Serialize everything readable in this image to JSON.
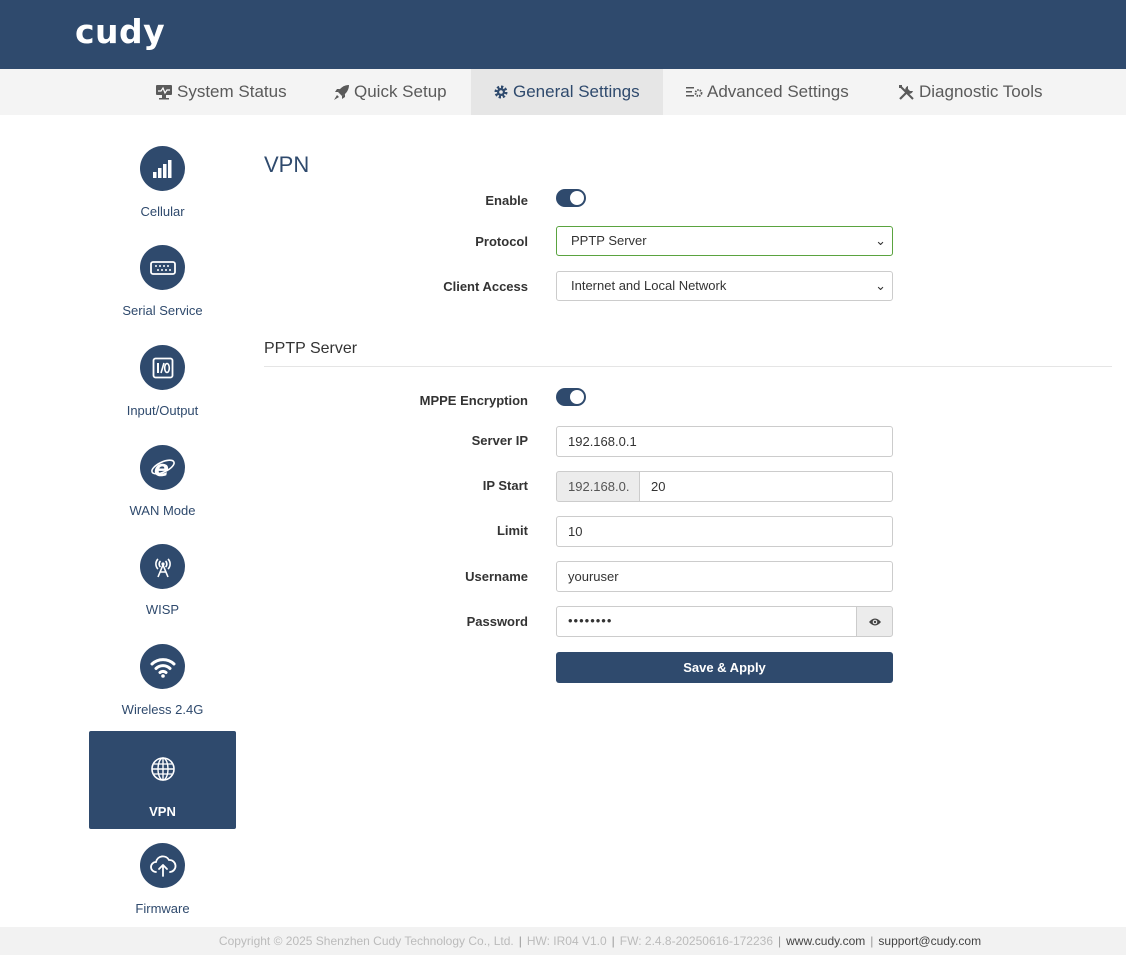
{
  "brand": {
    "logo": "cudy"
  },
  "nav": {
    "items": [
      {
        "label": "System Status",
        "icon": "monitor-icon"
      },
      {
        "label": "Quick Setup",
        "icon": "rocket-icon"
      },
      {
        "label": "General Settings",
        "icon": "gear-icon",
        "active": true
      },
      {
        "label": "Advanced Settings",
        "icon": "sliders-gear-icon"
      },
      {
        "label": "Diagnostic Tools",
        "icon": "tools-icon"
      }
    ]
  },
  "sidebar": {
    "items": [
      {
        "label": "Cellular",
        "icon": "signal-bars-icon"
      },
      {
        "label": "Serial Service",
        "icon": "serial-port-icon"
      },
      {
        "label": "Input/Output",
        "icon": "io-icon"
      },
      {
        "label": "WAN Mode",
        "icon": "internet-e-icon"
      },
      {
        "label": "WISP",
        "icon": "antenna-icon"
      },
      {
        "label": "Wireless 2.4G",
        "icon": "wifi-icon"
      },
      {
        "label": "VPN",
        "icon": "globe-icon",
        "active": true
      },
      {
        "label": "Firmware",
        "icon": "cloud-upload-icon"
      }
    ]
  },
  "vpn": {
    "title": "VPN",
    "enable_label": "Enable",
    "enable_on": true,
    "protocol_label": "Protocol",
    "protocol_value": "PPTP Server",
    "client_access_label": "Client Access",
    "client_access_value": "Internet and Local Network"
  },
  "pptp": {
    "title": "PPTP Server",
    "mppe_label": "MPPE Encryption",
    "mppe_on": true,
    "server_ip_label": "Server IP",
    "server_ip_value": "192.168.0.1",
    "ip_start_label": "IP Start",
    "ip_start_prefix": "192.168.0.",
    "ip_start_value": "20",
    "limit_label": "Limit",
    "limit_value": "10",
    "username_label": "Username",
    "username_value": "youruser",
    "password_label": "Password",
    "password_masked": "••••••••",
    "save_label": "Save & Apply"
  },
  "footer": {
    "copyright": "Copyright © 2025 Shenzhen Cudy Technology Co., Ltd.",
    "hw": "HW: IR04 V1.0",
    "fw": "FW: 2.4.8-20250616-172236",
    "website": "www.cudy.com",
    "email": "support@cudy.com"
  }
}
